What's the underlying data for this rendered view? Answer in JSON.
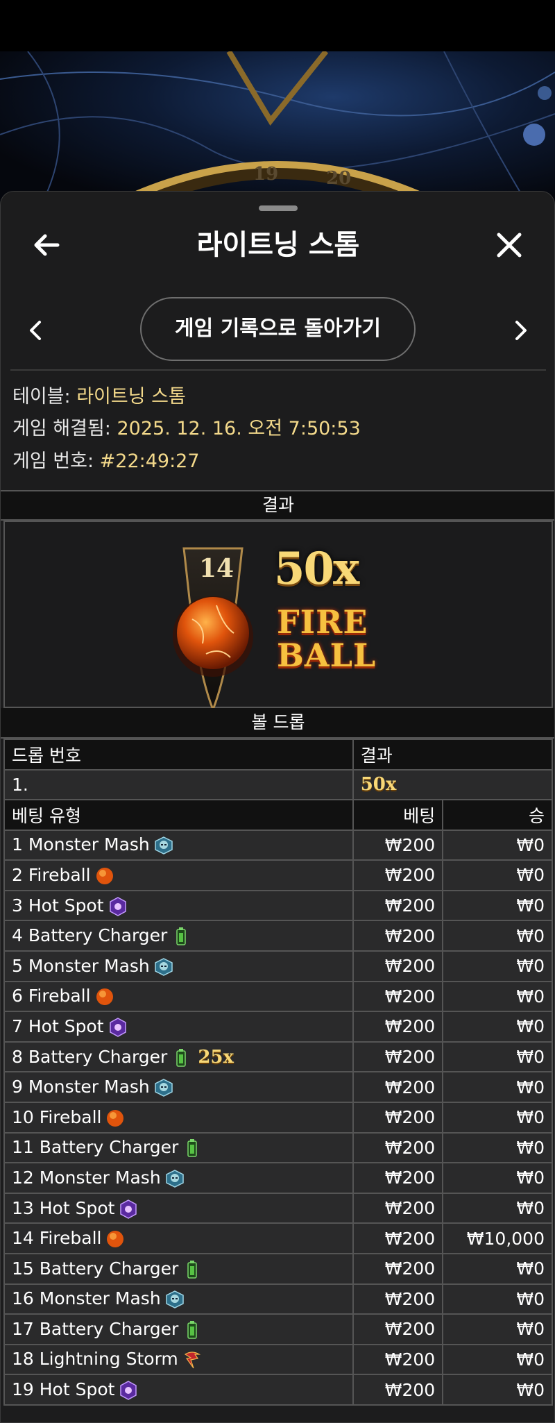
{
  "header": {
    "title": "라이트닝 스톰",
    "back_button": "게임 기록으로 돌아가기"
  },
  "game_wheel": {
    "numbers": [
      "19",
      "20"
    ]
  },
  "info": {
    "table_label": "테이블:",
    "table_value": "라이트닝 스톰",
    "resolved_label": "게임 해결됨:",
    "resolved_value": "2025. 12. 16. 오전 7:50:53",
    "game_no_label": "게임 번호:",
    "game_no_value": "#22:49:27"
  },
  "result": {
    "section_title": "결과",
    "slot_number": "14",
    "multiplier": "50x",
    "fire_word": "FIRE",
    "ball_word": "BALL"
  },
  "ball_drop": {
    "section_title": "볼 드롭",
    "col_drop_no": "드롭 번호",
    "col_result": "결과",
    "rows": [
      {
        "no": "1.",
        "result": "50x"
      }
    ]
  },
  "bets": {
    "col_type": "베팅 유형",
    "col_bet": "베팅",
    "col_win": "승",
    "rows": [
      {
        "label": "1 Monster Mash",
        "icon": "monster-icon",
        "extra": "",
        "bet": "₩200",
        "win": "₩0"
      },
      {
        "label": "2 Fireball",
        "icon": "fireball-icon",
        "extra": "",
        "bet": "₩200",
        "win": "₩0"
      },
      {
        "label": "3 Hot Spot",
        "icon": "hot-spot-icon",
        "extra": "",
        "bet": "₩200",
        "win": "₩0"
      },
      {
        "label": "4 Battery Charger",
        "icon": "battery-icon",
        "extra": "",
        "bet": "₩200",
        "win": "₩0"
      },
      {
        "label": "5 Monster Mash",
        "icon": "monster-icon",
        "extra": "",
        "bet": "₩200",
        "win": "₩0"
      },
      {
        "label": "6 Fireball",
        "icon": "fireball-icon",
        "extra": "",
        "bet": "₩200",
        "win": "₩0"
      },
      {
        "label": "7 Hot Spot",
        "icon": "hot-spot-icon",
        "extra": "",
        "bet": "₩200",
        "win": "₩0"
      },
      {
        "label": "8 Battery Charger",
        "icon": "battery-icon",
        "extra": "25x",
        "bet": "₩200",
        "win": "₩0"
      },
      {
        "label": "9 Monster Mash",
        "icon": "monster-icon",
        "extra": "",
        "bet": "₩200",
        "win": "₩0"
      },
      {
        "label": "10 Fireball",
        "icon": "fireball-icon",
        "extra": "",
        "bet": "₩200",
        "win": "₩0"
      },
      {
        "label": "11 Battery Charger",
        "icon": "battery-icon",
        "extra": "",
        "bet": "₩200",
        "win": "₩0"
      },
      {
        "label": "12 Monster Mash",
        "icon": "monster-icon",
        "extra": "",
        "bet": "₩200",
        "win": "₩0"
      },
      {
        "label": "13 Hot Spot",
        "icon": "hot-spot-icon",
        "extra": "",
        "bet": "₩200",
        "win": "₩0"
      },
      {
        "label": "14 Fireball",
        "icon": "fireball-icon",
        "extra": "",
        "bet": "₩200",
        "win": "₩10,000"
      },
      {
        "label": "15 Battery Charger",
        "icon": "battery-icon",
        "extra": "",
        "bet": "₩200",
        "win": "₩0"
      },
      {
        "label": "16 Monster Mash",
        "icon": "monster-icon",
        "extra": "",
        "bet": "₩200",
        "win": "₩0"
      },
      {
        "label": "17 Battery Charger",
        "icon": "battery-icon",
        "extra": "",
        "bet": "₩200",
        "win": "₩0"
      },
      {
        "label": "18 Lightning Storm",
        "icon": "lightning-icon",
        "extra": "",
        "bet": "₩200",
        "win": "₩0"
      },
      {
        "label": "19 Hot Spot",
        "icon": "hot-spot-icon",
        "extra": "",
        "bet": "₩200",
        "win": "₩0"
      }
    ]
  },
  "colors": {
    "accent_gold": "#f3d98b",
    "panel": "#1c1c1d",
    "row": "#2a2a2b"
  }
}
